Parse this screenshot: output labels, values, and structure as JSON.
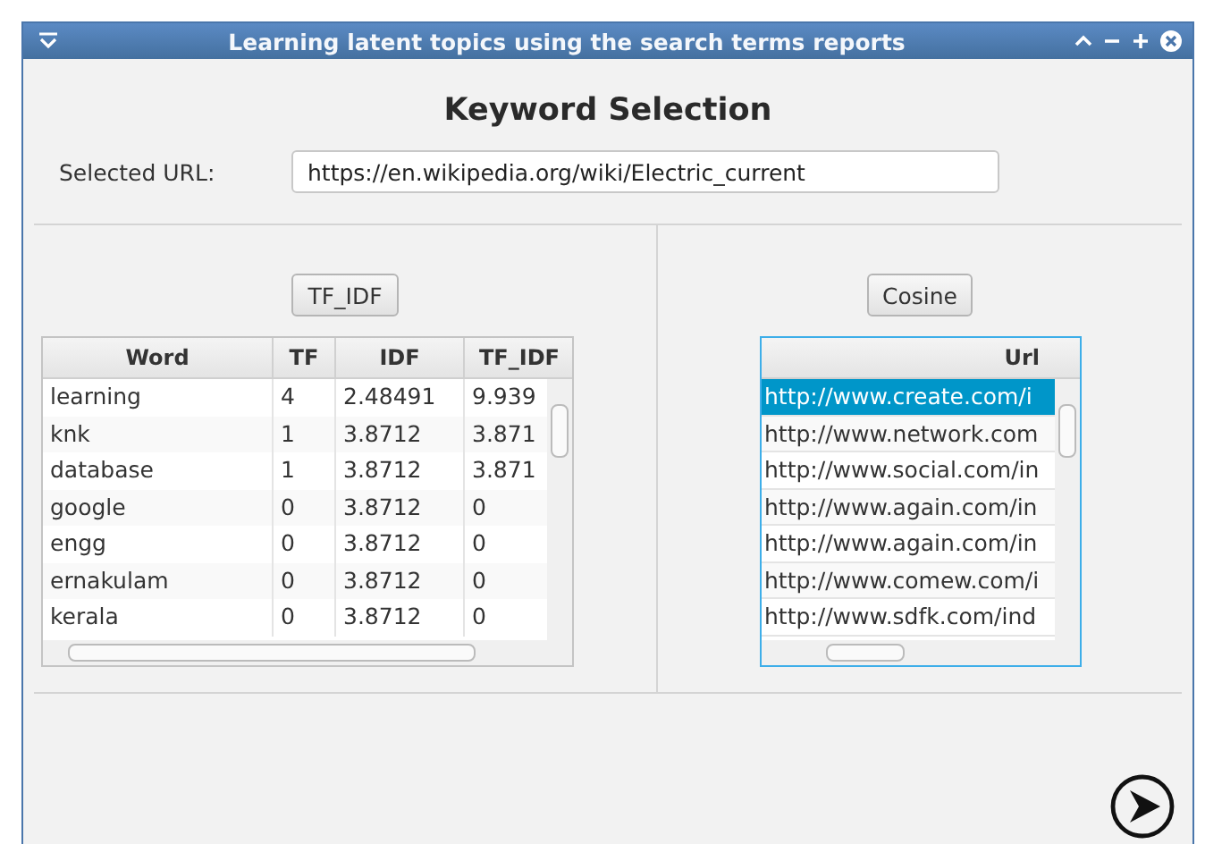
{
  "window": {
    "title": "Learning latent topics using the search terms reports"
  },
  "heading": "Keyword Selection",
  "url_field": {
    "label": "Selected URL:",
    "value": "https://en.wikipedia.org/wiki/Electric_current"
  },
  "tfidf": {
    "button": "TF_IDF",
    "columns": [
      "Word",
      "TF",
      "IDF",
      "TF_IDF"
    ],
    "rows": [
      [
        "learning",
        "4",
        "2.48491",
        "9.939"
      ],
      [
        "knk",
        "1",
        "3.8712",
        "3.871"
      ],
      [
        "database",
        "1",
        "3.8712",
        "3.871"
      ],
      [
        "google",
        "0",
        "3.8712",
        "0"
      ],
      [
        "engg",
        "0",
        "3.8712",
        "0"
      ],
      [
        "ernakulam",
        "0",
        "3.8712",
        "0"
      ],
      [
        "kerala",
        "0",
        "3.8712",
        "0"
      ]
    ]
  },
  "cosine": {
    "button": "Cosine",
    "column": "Url",
    "rows": [
      {
        "url": "http://www.create.com/i",
        "selected": true
      },
      {
        "url": "http://www.network.com",
        "selected": false
      },
      {
        "url": "http://www.social.com/in",
        "selected": false
      },
      {
        "url": "http://www.again.com/in",
        "selected": false
      },
      {
        "url": "http://www.again.com/in",
        "selected": false
      },
      {
        "url": "http://www.comew.com/i",
        "selected": false
      },
      {
        "url": "http://www.sdfk.com/ind",
        "selected": false
      }
    ]
  }
}
